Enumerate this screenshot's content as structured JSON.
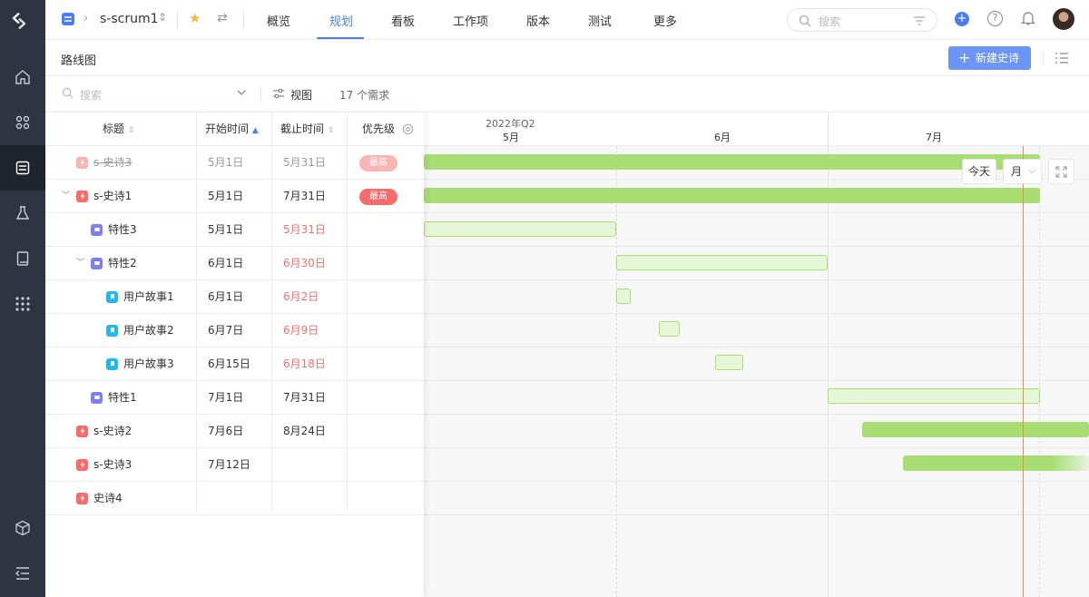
{
  "header": {
    "project_name": "s-scrum1",
    "tabs": [
      {
        "label": "概览"
      },
      {
        "label": "规划"
      },
      {
        "label": "看板"
      },
      {
        "label": "工作项"
      },
      {
        "label": "版本"
      },
      {
        "label": "测试"
      },
      {
        "label": "更多"
      }
    ],
    "active_tab": "规划",
    "search_placeholder": "搜索"
  },
  "page": {
    "title": "路线图",
    "new_button": "新建史诗"
  },
  "filter": {
    "search_placeholder": "搜索",
    "view_label": "视图",
    "count_label": "17 个需求"
  },
  "table": {
    "columns": [
      "标题",
      "开始时间",
      "截止时间",
      "优先级"
    ],
    "rows": [
      {
        "title": "s-史诗3",
        "start": "5月1日",
        "end": "5月31日",
        "priority": "最高"
      },
      {
        "title": "s-史诗1",
        "start": "5月1日",
        "end": "7月31日",
        "priority": "最高"
      },
      {
        "title": "特性3",
        "start": "5月1日",
        "end": "5月31日",
        "priority": ""
      },
      {
        "title": "特性2",
        "start": "6月1日",
        "end": "6月30日",
        "priority": ""
      },
      {
        "title": "用户故事1",
        "start": "6月1日",
        "end": "6月2日",
        "priority": ""
      },
      {
        "title": "用户故事2",
        "start": "6月7日",
        "end": "6月9日",
        "priority": ""
      },
      {
        "title": "用户故事3",
        "start": "6月15日",
        "end": "6月18日",
        "priority": ""
      },
      {
        "title": "特性1",
        "start": "7月1日",
        "end": "7月31日",
        "priority": ""
      },
      {
        "title": "s-史诗2",
        "start": "7月6日",
        "end": "8月24日",
        "priority": ""
      },
      {
        "title": "s-史诗3",
        "start": "7月12日",
        "end": "",
        "priority": ""
      },
      {
        "title": "史诗4",
        "start": "",
        "end": "",
        "priority": ""
      }
    ]
  },
  "timeline": {
    "quarter": "2022年Q2",
    "months": [
      "5月",
      "6月",
      "7月"
    ],
    "today_label": "今天",
    "scale_label": "月"
  },
  "colors": {
    "accent": "#4a7cf6",
    "epic_bar": "#a7dd73",
    "danger": "#f56c6c",
    "today_line": "#f08a4b"
  }
}
